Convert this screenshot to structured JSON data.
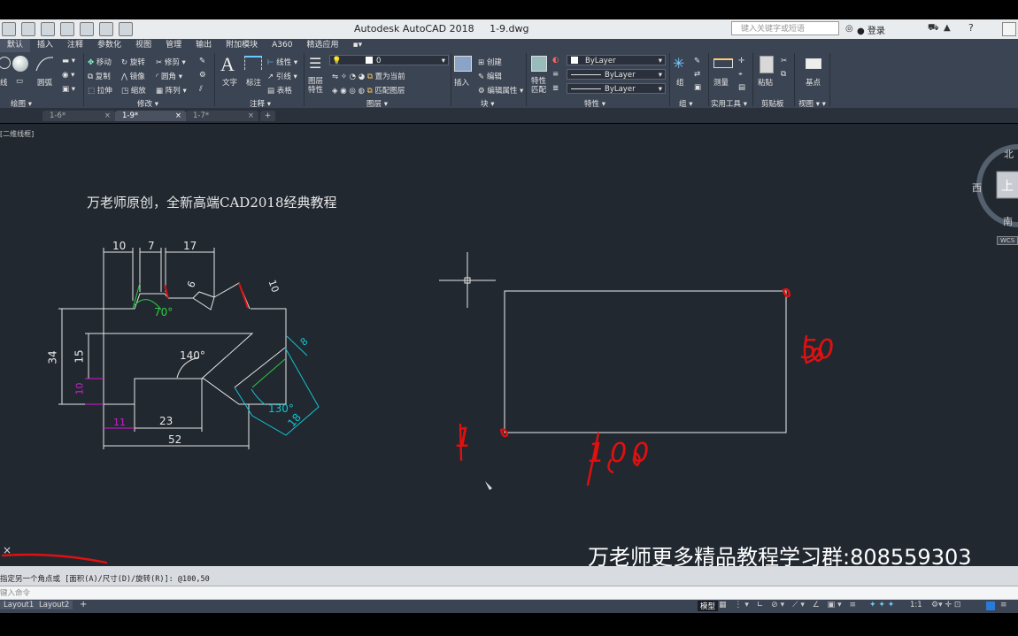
{
  "window": {
    "title": "Autodesk AutoCAD 2018",
    "filename": "1-9.dwg",
    "search_placeholder": "键入关键字或短语",
    "login_label": "登录"
  },
  "menu_tabs": [
    "默认",
    "插入",
    "注释",
    "参数化",
    "视图",
    "管理",
    "输出",
    "附加模块",
    "A360",
    "精选应用"
  ],
  "ribbon": {
    "draw_group": {
      "panel_label": "绘图 ▾",
      "arc_label": "圆弧",
      "line_label": "线"
    },
    "modify_group": {
      "panel_label": "修改 ▾",
      "items": [
        "移动",
        "旋转",
        "修剪",
        "复制",
        "镜像",
        "圆角",
        "拉伸",
        "缩放",
        "阵列"
      ]
    },
    "annotation_group": {
      "panel_label": "注释 ▾",
      "text_label": "文字",
      "dim_label": "标注",
      "items": [
        "线性",
        "引线",
        "表格"
      ]
    },
    "layers_group": {
      "panel_label": "图层 ▾",
      "layer_props_label": "图层特性",
      "current_layer": "0",
      "items": [
        "置为当前",
        "匹配图层"
      ]
    },
    "block_group": {
      "panel_label": "块 ▾",
      "insert_label": "插入",
      "items": [
        "创建",
        "编辑",
        "编辑属性 ▾"
      ]
    },
    "properties_group": {
      "panel_label": "特性 ▾",
      "match_label": "特性匹配",
      "color": "ByLayer",
      "linetype": "ByLayer",
      "lineweight": "ByLayer"
    },
    "groups_group": {
      "panel_label": "组 ▾",
      "label": "组"
    },
    "utilities_group": {
      "panel_label": "实用工具 ▾",
      "measure_label": "测量"
    },
    "clipboard_group": {
      "panel_label": "剪贴板",
      "paste_label": "粘贴"
    },
    "view_group": {
      "panel_label": "视图 ▾ ▾",
      "base_label": "基点"
    }
  },
  "doc_tabs": [
    "1-6*",
    "1-9*",
    "1-7*"
  ],
  "active_doc_tab": "1-9*",
  "viewport_label": "[二维线框]",
  "viewcube": {
    "north": "北",
    "west": "西",
    "south": "南",
    "top": "上",
    "wcs": "WCS"
  },
  "drawing": {
    "header_text": "万老师原创，全新高端CAD2018经典教程",
    "watermark": "万老师更多精品教程学习群:808559303",
    "dims_white": [
      "10",
      "7",
      "17",
      "6",
      "10",
      "34",
      "15",
      "140°",
      "23",
      "52"
    ],
    "dims_green": "70°",
    "dims_magenta": [
      "10",
      "11"
    ],
    "dims_cyan": [
      "8",
      "130°",
      "18"
    ],
    "handwriting": [
      "50",
      "100",
      "1"
    ]
  },
  "command": {
    "history": "指定另一个角点或 [面积(A)/尺寸(D)/旋转(R)]: @100,50",
    "prompt_placeholder": "键入命令"
  },
  "layout_tabs": [
    "Layout1",
    "Layout2"
  ],
  "status": {
    "model_label": "模型",
    "scale": "1:1"
  },
  "colors": {
    "canvas": "#212830",
    "ribbon": "#3b4453",
    "green": "#2ecc40",
    "magenta": "#d21cd2",
    "cyan": "#12c4d0",
    "red_ink": "#e01010"
  }
}
